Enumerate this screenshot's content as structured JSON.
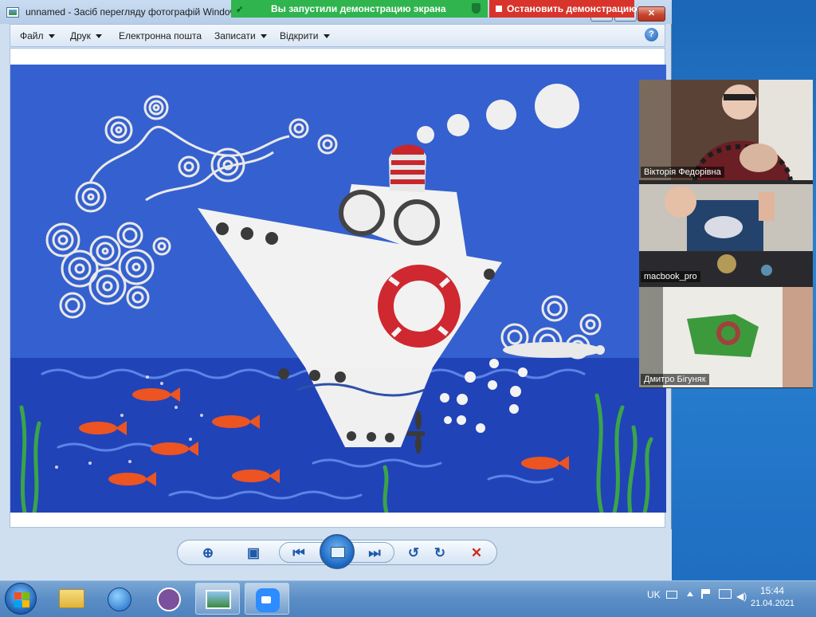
{
  "window": {
    "title": "unnamed - Засіб перегляду фотографій Windows",
    "close_label": "✕"
  },
  "menu": {
    "items": [
      {
        "label": "Файл"
      },
      {
        "label": "Друк"
      },
      {
        "label": "Електронна пошта"
      },
      {
        "label": "Записати"
      },
      {
        "label": "Відкрити"
      }
    ],
    "help_label": "?"
  },
  "share": {
    "status_text": "Вы запустили демонстрацию экрана",
    "stop_label": "Остановить демонстрацию"
  },
  "participants": [
    {
      "name": "Вікторія Федорівна"
    },
    {
      "name": "macbook_pro"
    },
    {
      "name": "Дмитро Бігуняк"
    }
  ],
  "tray": {
    "language": "UK",
    "time": "15:44",
    "date": "21.04.2021"
  },
  "colors": {
    "share_green": "#2fb44e",
    "stop_red": "#d8342b",
    "photo_sky": "#2f55c8",
    "photo_sea": "#1f3fb6"
  }
}
